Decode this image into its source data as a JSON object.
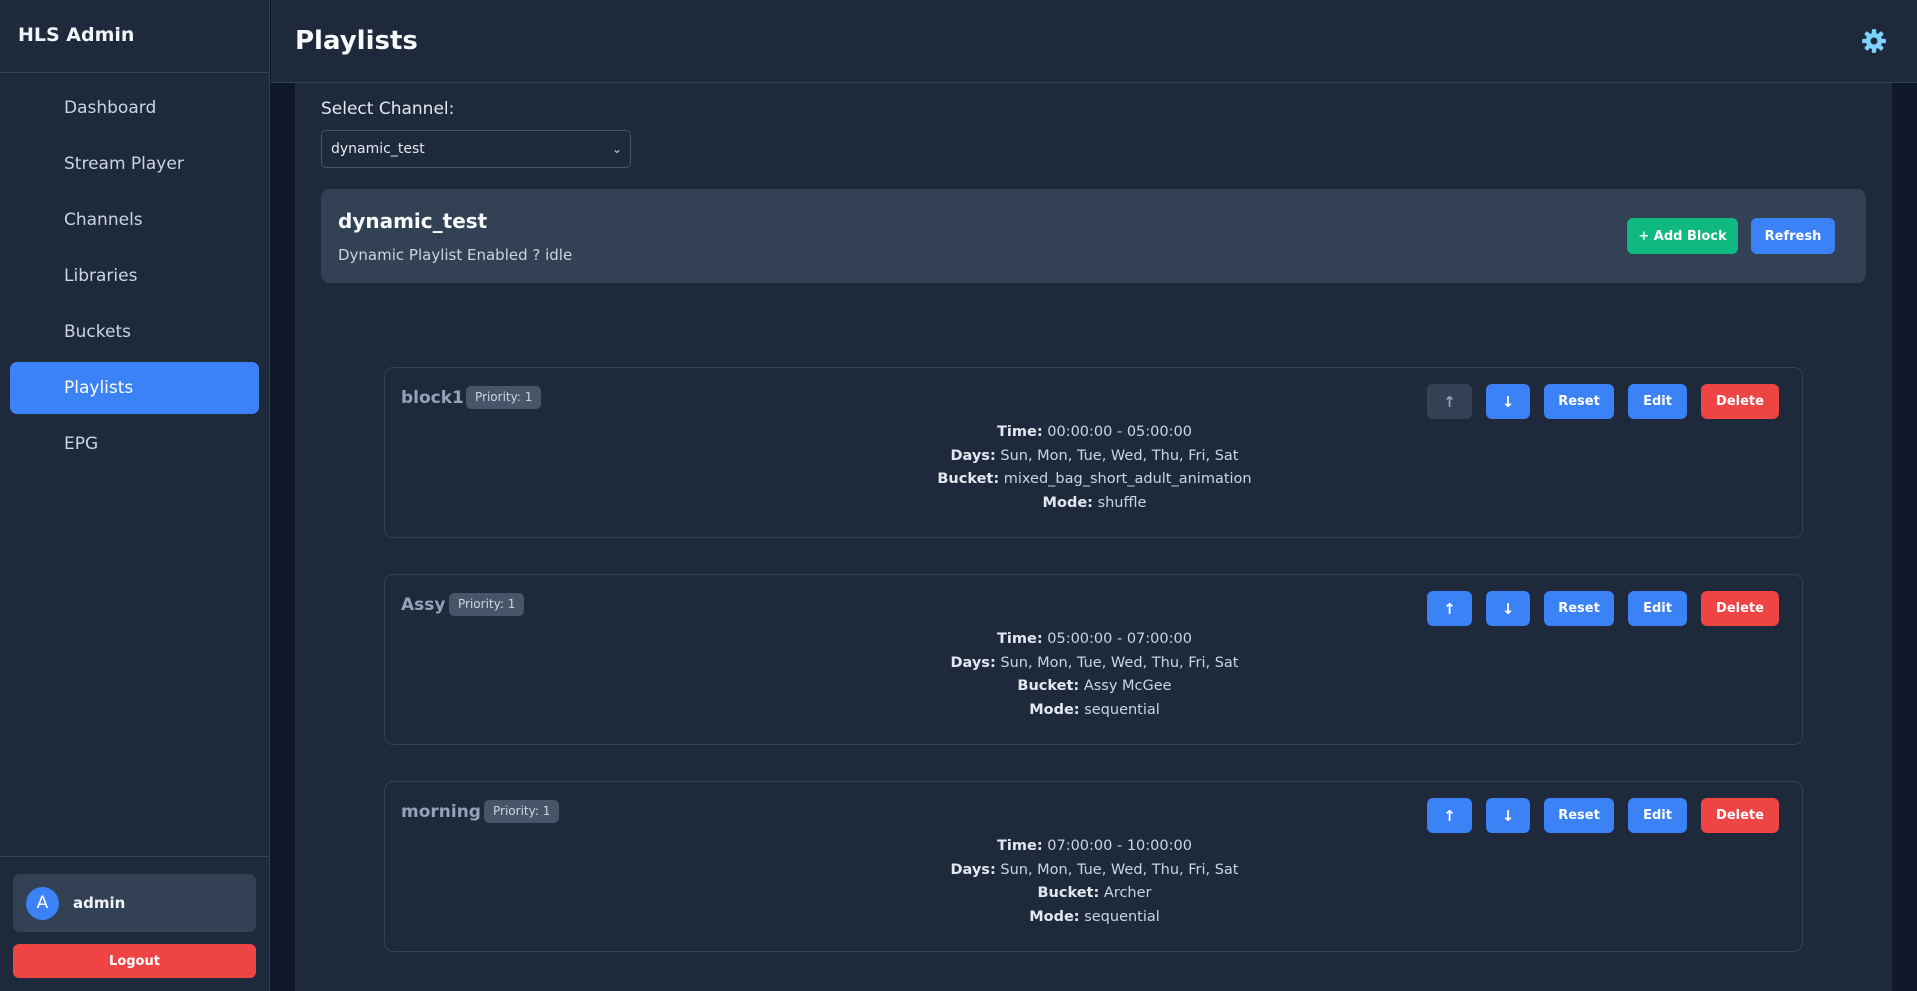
{
  "app": {
    "title": "HLS Admin"
  },
  "sidebar": {
    "items": [
      {
        "label": "Dashboard",
        "active": false
      },
      {
        "label": "Stream Player",
        "active": false
      },
      {
        "label": "Channels",
        "active": false
      },
      {
        "label": "Libraries",
        "active": false
      },
      {
        "label": "Buckets",
        "active": false
      },
      {
        "label": "Playlists",
        "active": true
      },
      {
        "label": "EPG",
        "active": false
      }
    ],
    "user": {
      "avatar_letter": "A",
      "name": "admin"
    },
    "logout_label": "Logout"
  },
  "header": {
    "title": "Playlists",
    "settings_icon": "gear-icon"
  },
  "channel_select": {
    "label": "Select Channel:",
    "value": "dynamic_test"
  },
  "channel_panel": {
    "name": "dynamic_test",
    "status": "Dynamic Playlist Enabled ? idle",
    "add_block_label": "+ Add Block",
    "refresh_label": "Refresh"
  },
  "block_labels": {
    "time": "Time:",
    "days": "Days:",
    "bucket": "Bucket:",
    "mode": "Mode:",
    "up": "↑",
    "down": "↓",
    "reset": "Reset",
    "edit": "Edit",
    "delete": "Delete"
  },
  "blocks": [
    {
      "name": "block1",
      "priority": "Priority: 1",
      "time": "00:00:00 - 05:00:00",
      "days": "Sun, Mon, Tue, Wed, Thu, Fri, Sat",
      "bucket": "mixed_bag_short_adult_animation",
      "mode": "shuffle",
      "up_disabled": true
    },
    {
      "name": "Assy",
      "priority": "Priority: 1",
      "time": "05:00:00 - 07:00:00",
      "days": "Sun, Mon, Tue, Wed, Thu, Fri, Sat",
      "bucket": "Assy McGee",
      "mode": "sequential",
      "up_disabled": false
    },
    {
      "name": "morning",
      "priority": "Priority: 1",
      "time": "07:00:00 - 10:00:00",
      "days": "Sun, Mon, Tue, Wed, Thu, Fri, Sat",
      "bucket": "Archer",
      "mode": "sequential",
      "up_disabled": false
    }
  ],
  "colors": {
    "accent": "#3b82f6",
    "success": "#10b981",
    "danger": "#ef4444",
    "background": "#1e293b",
    "panel": "#334155"
  }
}
